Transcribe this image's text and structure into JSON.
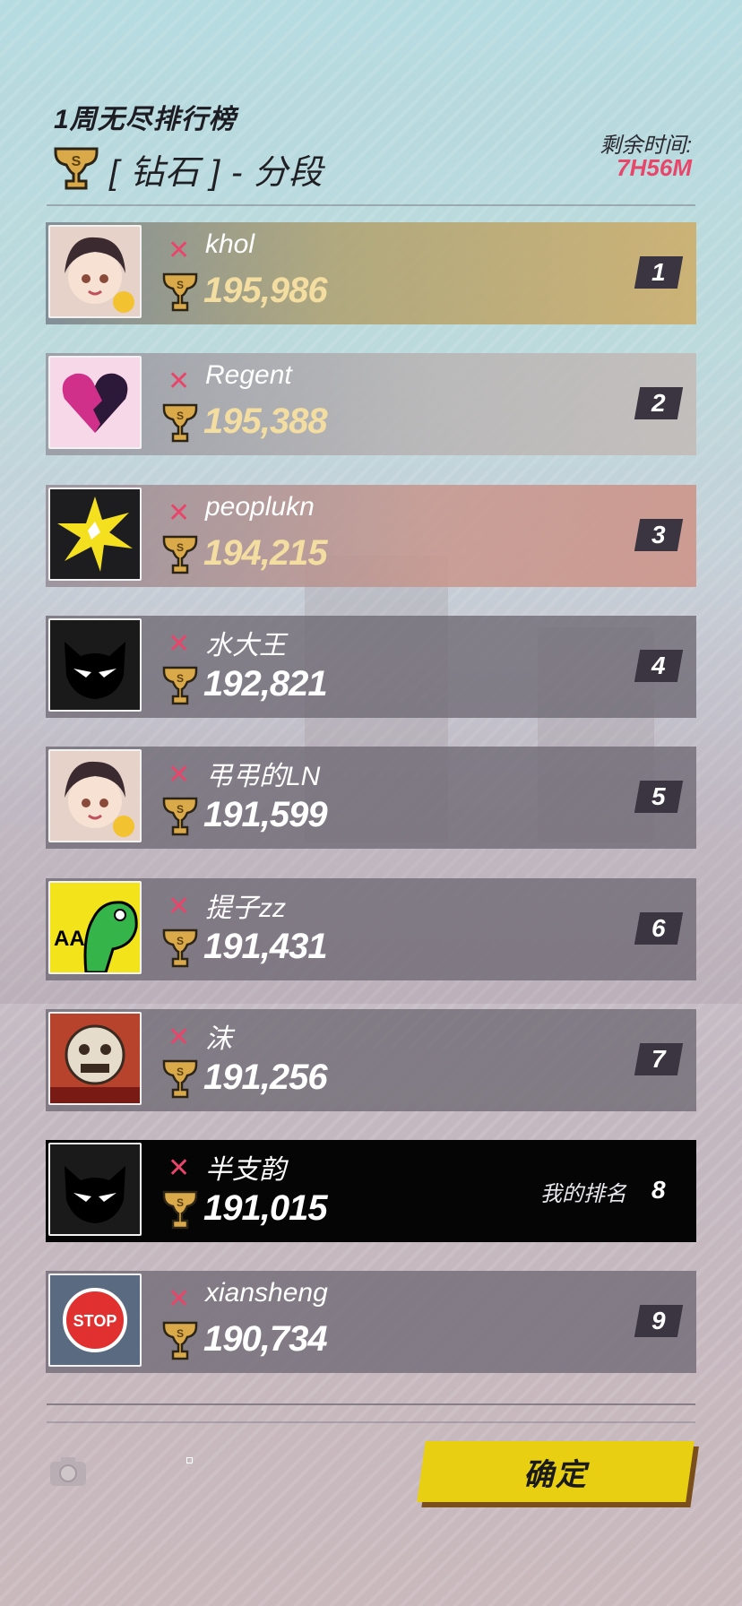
{
  "header": {
    "title": "1周无尽排行榜",
    "tier": "[ 钻石 ] - 分段",
    "time_label": "剩余时间:",
    "time_value": "7H56M"
  },
  "leaderboard": [
    {
      "rank": "1",
      "name": "khol",
      "score": "195,986",
      "avatar": "anime-girl-avatar"
    },
    {
      "rank": "2",
      "name": "Regent",
      "score": "195,388",
      "avatar": "broken-heart-avatar"
    },
    {
      "rank": "3",
      "name": "peoplukn",
      "score": "194,215",
      "avatar": "explosion-avatar"
    },
    {
      "rank": "4",
      "name": "水大王",
      "score": "192,821",
      "avatar": "black-cat-avatar"
    },
    {
      "rank": "5",
      "name": "弔弔的LN",
      "score": "191,599",
      "avatar": "anime-girl-avatar"
    },
    {
      "rank": "6",
      "name": "提子zz",
      "score": "191,431",
      "avatar": "green-dino-avatar"
    },
    {
      "rank": "7",
      "name": "沫",
      "score": "191,256",
      "avatar": "lion-mask-avatar"
    },
    {
      "rank": "8",
      "name": "半支韵",
      "score": "191,015",
      "avatar": "black-cat-avatar",
      "my_rank_label": "我的排名"
    },
    {
      "rank": "9",
      "name": "xiansheng",
      "score": "190,734",
      "avatar": "stop-sign-avatar"
    }
  ],
  "footer": {
    "confirm_label": "确定"
  },
  "colors": {
    "accent_pink": "#e8456b",
    "gold_score": "#f3dda0",
    "confirm_yellow": "#e9cf12"
  }
}
